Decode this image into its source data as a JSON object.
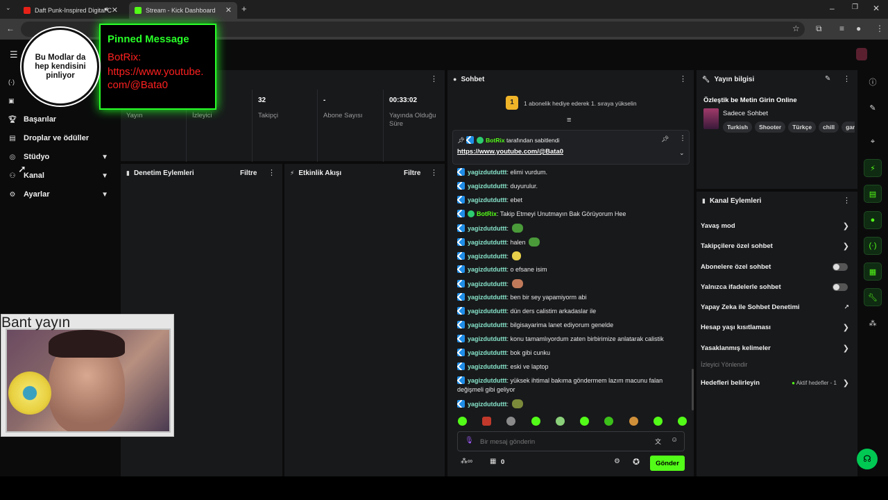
{
  "browser": {
    "tabs": [
      {
        "title": "Daft Punk-Inspired Digital C",
        "favicon_color": "#e62117"
      },
      {
        "title": "Stream - Kick Dashboard",
        "favicon_color": "#53fc18"
      }
    ]
  },
  "overlay": {
    "pinned_title": "Pinned Message",
    "pinned_user": "BotRix:",
    "pinned_link": "https://www.youtube.com/@Bata0",
    "circle_text": "Bu Modlar da hep kendisini pinliyor",
    "cam_title": "Bant yayın"
  },
  "sidebar": {
    "items": [
      {
        "label": "Başarılar",
        "icon": "trophy-icon"
      },
      {
        "label": "Droplar ve ödüller",
        "icon": "drops-icon"
      },
      {
        "label": "Stüdyo",
        "icon": "studio-icon"
      },
      {
        "label": "Kanal",
        "icon": "channel-icon"
      },
      {
        "label": "Ayarlar",
        "icon": "gear-icon"
      }
    ]
  },
  "stats": [
    {
      "value": "",
      "label": "Yayın"
    },
    {
      "value": "",
      "label": "İzleyici"
    },
    {
      "value": "32",
      "label": "Takipçi"
    },
    {
      "value": "-",
      "label": "Abone Sayısı"
    },
    {
      "value": "00:33:02",
      "label": "Yayında Olduğu Süre"
    }
  ],
  "panels": {
    "moderation": "Denetim Eylemleri",
    "activity": "Etkinlik Akışı",
    "filter": "Filtre"
  },
  "chat": {
    "title": "Sohbet",
    "sub_gift_rank": "1",
    "sub_gift_text": "1 abonelik hediye ederek 1. sıraya yükselin",
    "pinned_by": "BotRix",
    "pinned_by_suffix": "tarafından sabitlendi",
    "pinned_link": "https://www.youtube.com/@Bata0",
    "messages": [
      {
        "user": "yagizdutduttt",
        "text": "elimi vurdum."
      },
      {
        "user": "yagizdutduttt",
        "text": "duyurulur."
      },
      {
        "user": "yagizdutduttt",
        "text": "ebet"
      },
      {
        "user": "BotRix",
        "text": "Takip Etmeyi Unutmayın Bak Görüyorum Hee"
      },
      {
        "user": "yagizdutduttt",
        "text": ""
      },
      {
        "user": "yagizdutduttt",
        "text": "halen"
      },
      {
        "user": "yagizdutduttt",
        "text": ""
      },
      {
        "user": "yagizdutduttt",
        "text": "o efsane isim"
      },
      {
        "user": "yagizdutduttt",
        "text": ""
      },
      {
        "user": "yagizdutduttt",
        "text": "ben bir sey yapamiyorm abi"
      },
      {
        "user": "yagizdutduttt",
        "text": "dün ders calistim arkadaslar ile"
      },
      {
        "user": "yagizdutduttt",
        "text": "bilgisayarima lanet ediyorum genelde"
      },
      {
        "user": "yagizdutduttt",
        "text": "konu tamamlıyordum zaten birbirimize anlatarak calistik"
      },
      {
        "user": "yagizdutduttt",
        "text": "bok gibi cunku"
      },
      {
        "user": "yagizdutduttt",
        "text": "eski ve laptop"
      },
      {
        "user": "yagizdutduttt",
        "text": "yüksek ihtimal bakıma göndermem lazım macunu falan değişmeli gibi geliyor"
      },
      {
        "user": "yagizdutduttt",
        "text": ""
      }
    ],
    "input_placeholder": "Bir mesaj gönderin",
    "points": "0",
    "send_label": "Gönder"
  },
  "stream_info": {
    "title": "Yayın bilgisi",
    "stream_title": "Özleştik be Metin Girin Online",
    "category": "Sadece Sohbet",
    "tags": [
      "Turkish",
      "Shooter",
      "Türkçe",
      "chill",
      "gar"
    ]
  },
  "channel_actions": {
    "title": "Kanal Eylemleri",
    "items": [
      {
        "label": "Yavaş mod",
        "control": "chevron"
      },
      {
        "label": "Takipçilere özel sohbet",
        "control": "chevron"
      },
      {
        "label": "Abonelere özel sohbet",
        "control": "toggle"
      },
      {
        "label": "Yalnızca ifadelerle sohbet",
        "control": "toggle"
      },
      {
        "label": "Yapay Zeka ile Sohbet Denetimi",
        "control": "external"
      },
      {
        "label": "Hesap yaşı kısıtlaması",
        "control": "chevron"
      },
      {
        "label": "Yasaklanmış kelimeler",
        "control": "chevron"
      }
    ],
    "section": "İzleyici Yönlendir",
    "goals_label": "Hedefleri belirleyin",
    "goals_status": "Aktif hedefler - 1"
  },
  "colors": {
    "accent": "#53fc18",
    "panel": "#18191b",
    "bg": "#0b0b0c"
  }
}
